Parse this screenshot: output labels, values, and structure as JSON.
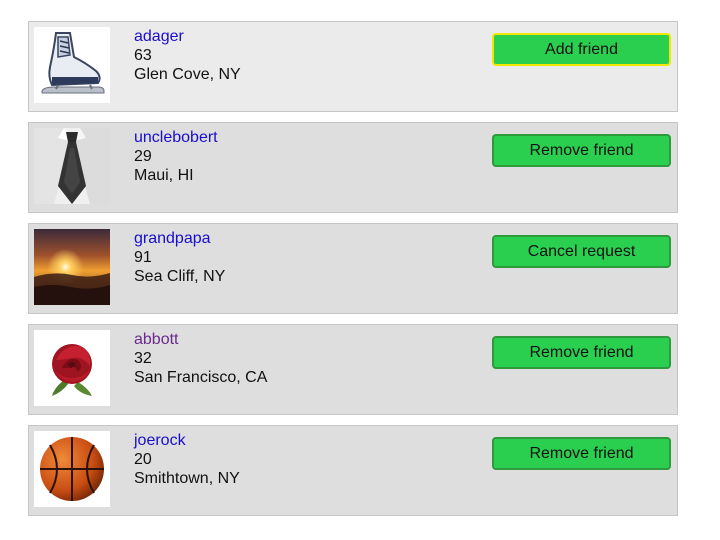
{
  "friends": [
    {
      "username": "adager",
      "age": "63",
      "location": "Glen Cove, NY",
      "button_label": "Add friend",
      "avatar_icon": "ice-skate-icon"
    },
    {
      "username": "unclebobert",
      "age": "29",
      "location": "Maui, HI",
      "button_label": "Remove friend",
      "avatar_icon": "necktie-icon"
    },
    {
      "username": "grandpapa",
      "age": "91",
      "location": "Sea Cliff, NY",
      "button_label": "Cancel request",
      "avatar_icon": "sunset-icon"
    },
    {
      "username": "abbott",
      "age": "32",
      "location": "San Francisco, CA",
      "button_label": "Remove friend",
      "avatar_icon": "rose-icon"
    },
    {
      "username": "joerock",
      "age": "20",
      "location": "Smithtown, NY",
      "button_label": "Remove friend",
      "avatar_icon": "basketball-icon"
    }
  ],
  "colors": {
    "button_green": "#2bcf4f",
    "link_blue": "#1a0dcc",
    "link_visited": "#6a2a8e",
    "focus_ring": "#f3e600"
  }
}
